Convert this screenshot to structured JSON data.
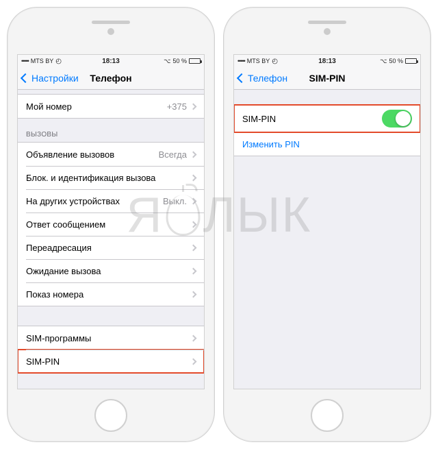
{
  "statusbar": {
    "carrier": "MTS BY",
    "time": "18:13",
    "battery_pct": "50 %"
  },
  "left": {
    "back_label": "Настройки",
    "title": "Телефон",
    "my_number": {
      "label": "Мой номер",
      "value": "+375"
    },
    "section_calls": "ВЫЗОВЫ",
    "rows": {
      "announce": {
        "label": "Объявление вызовов",
        "value": "Всегда"
      },
      "block_id": {
        "label": "Блок. и идентификация вызова"
      },
      "other_devices": {
        "label": "На других устройствах",
        "value": "Выкл."
      },
      "respond_msg": {
        "label": "Ответ сообщением"
      },
      "forwarding": {
        "label": "Переадресация"
      },
      "waiting": {
        "label": "Ожидание вызова"
      },
      "show_number": {
        "label": "Показ номера"
      },
      "sim_apps": {
        "label": "SIM-программы"
      },
      "sim_pin": {
        "label": "SIM-PIN"
      }
    }
  },
  "right": {
    "back_label": "Телефон",
    "title": "SIM-PIN",
    "rows": {
      "sim_pin": {
        "label": "SIM-PIN"
      },
      "change_pin": {
        "label": "Изменить PIN"
      }
    }
  },
  "watermark": {
    "l": "Я",
    "r": "ЛЫК"
  }
}
